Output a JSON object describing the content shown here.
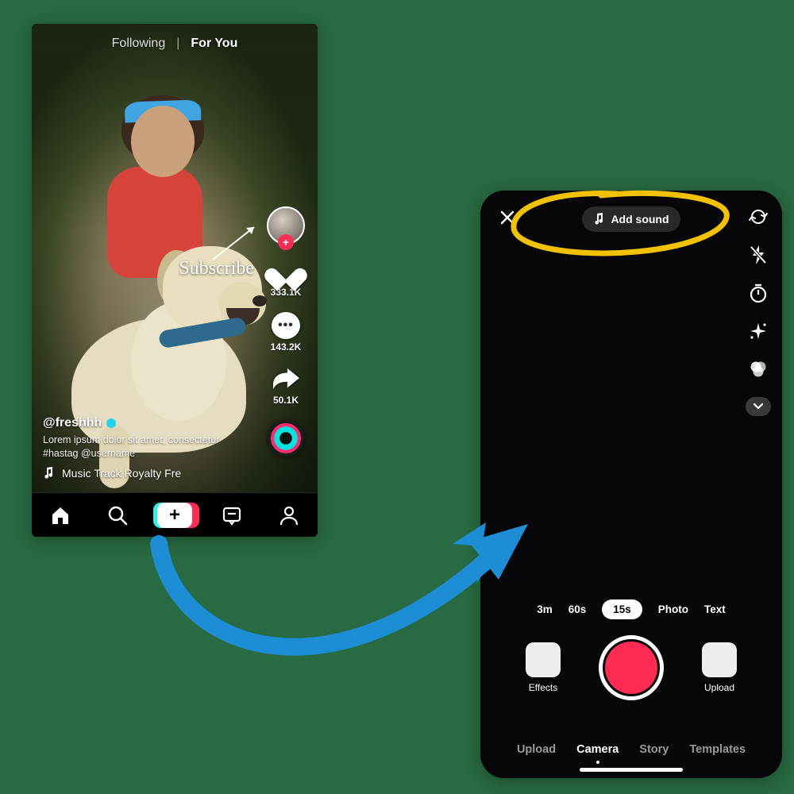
{
  "feed": {
    "tabs": {
      "following": "Following",
      "foryou": "For You"
    },
    "subscribe_label": "Subscribe",
    "side": {
      "like_count": "333.1K",
      "comment_count": "143.2K",
      "share_count": "50.1K"
    },
    "caption": {
      "username": "@freshhh",
      "text": "Lorem ipsum dolor sit amet, consectetur #hastag @username",
      "music": "Music Track   Royalty Fre"
    }
  },
  "camera": {
    "add_sound": "Add sound",
    "durations": {
      "d0": "3m",
      "d1": "60s",
      "d2": "15s",
      "d3": "Photo",
      "d4": "Text"
    },
    "effects_label": "Effects",
    "upload_label": "Upload",
    "modes": {
      "m0": "Upload",
      "m1": "Camera",
      "m2": "Story",
      "m3": "Templates"
    }
  },
  "colors": {
    "accent": "#fe2c55",
    "annotation_yellow": "#f2c200",
    "annotation_blue": "#1d8dd6"
  }
}
